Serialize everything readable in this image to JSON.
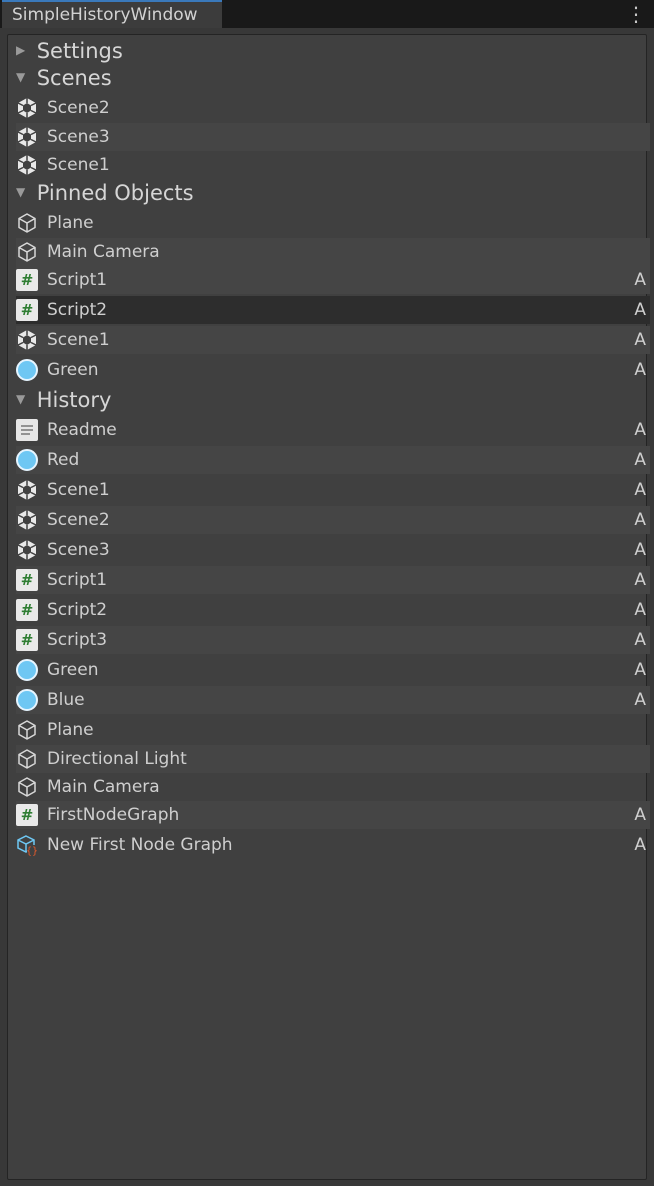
{
  "window": {
    "title": "SimpleHistoryWindow",
    "menu_icon": "vertical-ellipsis-icon"
  },
  "sections": {
    "settings": {
      "label": "Settings",
      "expanded": false
    },
    "scenes": {
      "label": "Scenes",
      "expanded": true
    },
    "pinned": {
      "label": "Pinned Objects",
      "expanded": true
    },
    "history": {
      "label": "History",
      "expanded": true
    }
  },
  "scenes": [
    {
      "label": "Scene2",
      "icon": "unity-scene-icon"
    },
    {
      "label": "Scene3",
      "icon": "unity-scene-icon"
    },
    {
      "label": "Scene1",
      "icon": "unity-scene-icon"
    }
  ],
  "pinned": [
    {
      "label": "Plane",
      "icon": "gameobject-cube-icon",
      "flag": ""
    },
    {
      "label": "Main Camera",
      "icon": "gameobject-cube-icon",
      "flag": ""
    },
    {
      "label": "Script1",
      "icon": "csharp-script-icon",
      "flag": "A"
    },
    {
      "label": "Script2",
      "icon": "csharp-script-icon",
      "flag": "A"
    },
    {
      "label": "Scene1",
      "icon": "unity-scene-icon",
      "flag": "A"
    },
    {
      "label": "Green",
      "icon": "material-sphere-icon",
      "flag": "A"
    }
  ],
  "history": [
    {
      "label": "Readme",
      "icon": "text-document-icon",
      "flag": "A"
    },
    {
      "label": "Red",
      "icon": "material-sphere-icon",
      "flag": "A"
    },
    {
      "label": "Scene1",
      "icon": "unity-scene-icon",
      "flag": "A"
    },
    {
      "label": "Scene2",
      "icon": "unity-scene-icon",
      "flag": "A"
    },
    {
      "label": "Scene3",
      "icon": "unity-scene-icon",
      "flag": "A"
    },
    {
      "label": "Script1",
      "icon": "csharp-script-icon",
      "flag": "A"
    },
    {
      "label": "Script2",
      "icon": "csharp-script-icon",
      "flag": "A"
    },
    {
      "label": "Script3",
      "icon": "csharp-script-icon",
      "flag": "A"
    },
    {
      "label": "Green",
      "icon": "material-sphere-icon",
      "flag": "A"
    },
    {
      "label": "Blue",
      "icon": "material-sphere-icon",
      "flag": "A"
    },
    {
      "label": "Plane",
      "icon": "gameobject-cube-icon",
      "flag": ""
    },
    {
      "label": "Directional Light",
      "icon": "gameobject-cube-icon",
      "flag": ""
    },
    {
      "label": "Main Camera",
      "icon": "gameobject-cube-icon",
      "flag": ""
    },
    {
      "label": "FirstNodeGraph",
      "icon": "csharp-script-icon",
      "flag": "A"
    },
    {
      "label": "New First Node Graph",
      "icon": "scriptable-object-icon",
      "flag": "A"
    }
  ],
  "colors": {
    "accent": "#3a79bb",
    "script_green": "#2e7d32",
    "material_blue": "#6ec7f3",
    "selected_row": "#2d2d2d"
  }
}
